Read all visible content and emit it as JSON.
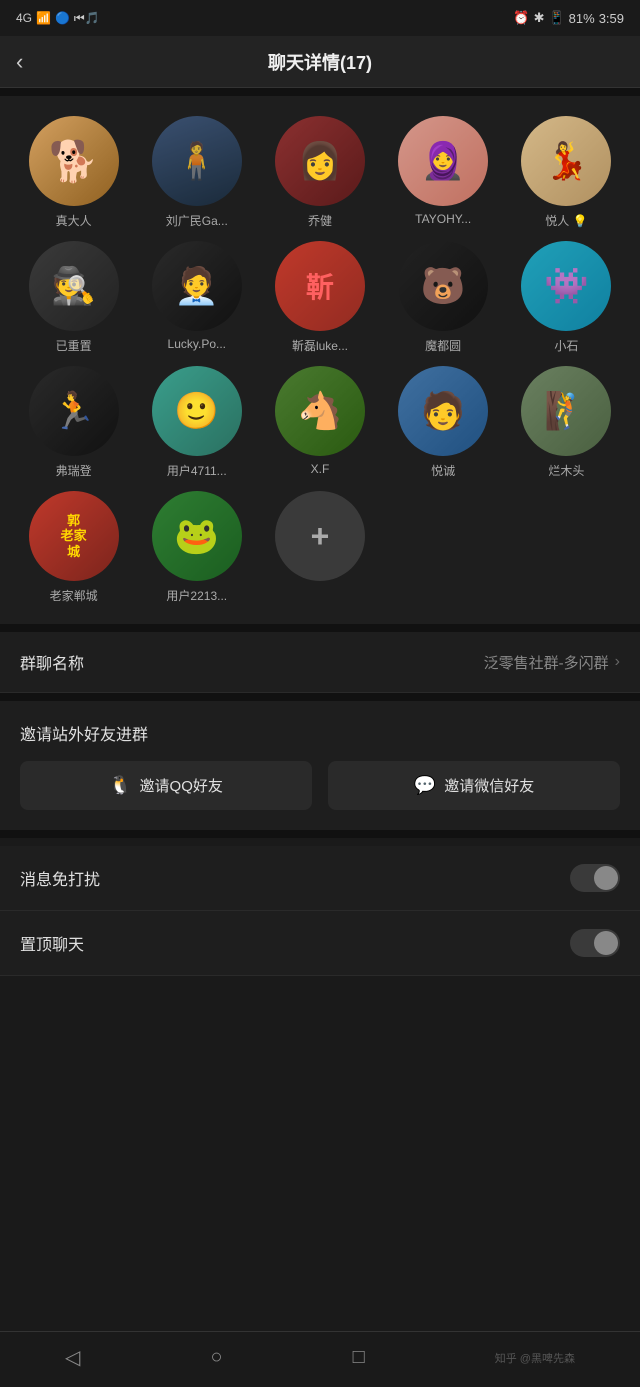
{
  "statusBar": {
    "left": "4G",
    "time": "3:59",
    "battery": "81%"
  },
  "header": {
    "back": "‹",
    "title": "聊天详情(17)"
  },
  "members": [
    {
      "id": 1,
      "name": "真大人",
      "avatarType": "shiba",
      "emoji": "🐕"
    },
    {
      "id": 2,
      "name": "刘广民Ga...",
      "avatarType": "man-silhouette",
      "emoji": "🧍"
    },
    {
      "id": 3,
      "name": "乔健",
      "avatarType": "woman-red",
      "emoji": "👩"
    },
    {
      "id": 4,
      "name": "TAYOHY...",
      "avatarType": "pink-lady",
      "emoji": "👗"
    },
    {
      "id": 5,
      "name": "悦人 💡",
      "avatarType": "vintage-lady",
      "emoji": "👩"
    },
    {
      "id": 6,
      "name": "已重置",
      "avatarType": "hat-man",
      "emoji": "🎩"
    },
    {
      "id": 7,
      "name": "Lucky.Po...",
      "avatarType": "suit-man",
      "emoji": "🕴"
    },
    {
      "id": 8,
      "name": "靳磊luke...",
      "avatarType": "red-char",
      "char": "靳"
    },
    {
      "id": 9,
      "name": "魔都圆",
      "avatarType": "bear",
      "emoji": "🐻"
    },
    {
      "id": 10,
      "name": "小石",
      "avatarType": "blue-alien",
      "emoji": "👾"
    },
    {
      "id": 11,
      "name": "弗瑞登",
      "avatarType": "runner",
      "emoji": "🏃"
    },
    {
      "id": 12,
      "name": "用户4711...",
      "avatarType": "monster",
      "emoji": "👾"
    },
    {
      "id": 13,
      "name": "X.F",
      "avatarType": "horse",
      "emoji": "🐴"
    },
    {
      "id": 14,
      "name": "悦诚",
      "avatarType": "couple",
      "emoji": "🧑"
    },
    {
      "id": 15,
      "name": "烂木头",
      "avatarType": "outdoor",
      "emoji": "🧗"
    },
    {
      "id": 16,
      "name": "老家郸城",
      "avatarType": "guo",
      "char": "郭老家城"
    },
    {
      "id": 17,
      "name": "用户2213...",
      "avatarType": "frog",
      "emoji": "🐸"
    },
    {
      "id": 18,
      "name": "+",
      "avatarType": "plus",
      "isAdd": true
    }
  ],
  "groupNameRow": {
    "label": "群聊名称",
    "value": "泛零售社群-多闪群",
    "chevron": "›"
  },
  "inviteSection": {
    "label": "邀请站外好友进群",
    "qqButton": "邀请QQ好友",
    "wechatButton": "邀请微信好友",
    "qqIcon": "Q",
    "wechatIcon": "W"
  },
  "toggleRows": [
    {
      "label": "消息免打扰",
      "enabled": false
    },
    {
      "label": "置顶聊天",
      "enabled": false
    }
  ],
  "bottomNav": {
    "back": "◁",
    "home": "○",
    "recents": "□",
    "watermark": "知乎 @黑啤先森"
  }
}
